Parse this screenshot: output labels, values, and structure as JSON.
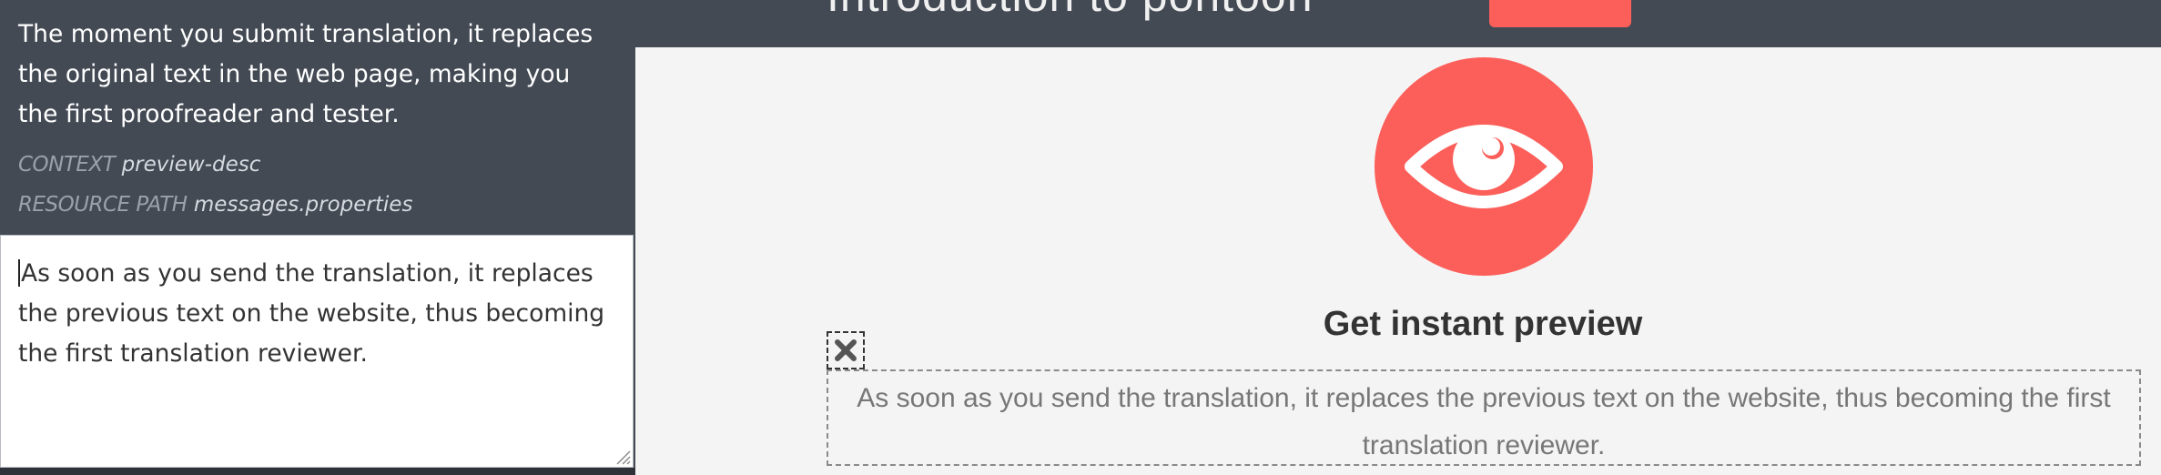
{
  "sidebar": {
    "original_text": "The moment you submit translation, it replaces the original text in the web page, making you the first proofreader and tester.",
    "context_label": "CONTEXT",
    "context_value": "preview-desc",
    "resource_path_label": "RESOURCE PATH",
    "resource_path_value": "messages.properties",
    "translation_text": "As soon as you send the translation, it replaces the previous text on the website, thus becoming the first translation reviewer."
  },
  "page": {
    "header_title": "Introduction to pontoon",
    "feature_heading": "Get instant preview",
    "feature_text": "As soon as you send the translation, it replaces the previous text on the website, thus becoming the first translation reviewer."
  },
  "icons": {
    "eye": "eye-icon",
    "close": "close-icon",
    "resize": "resize-handle-icon"
  },
  "colors": {
    "sidebar_bg": "#434a54",
    "accent": "#fc5f5a",
    "page_bg": "#f4f4f4"
  }
}
